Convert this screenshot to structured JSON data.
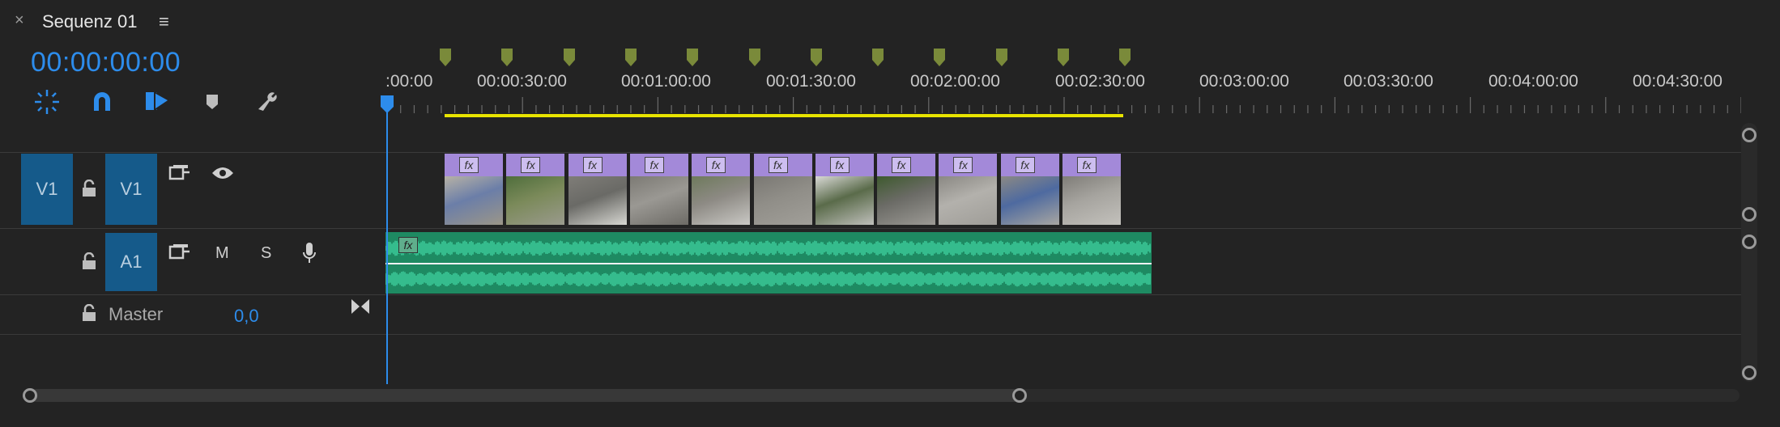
{
  "panel": {
    "close_glyph": "×",
    "title": "Sequenz 01",
    "menu_glyph": "≡"
  },
  "timecode": "00:00:00:00",
  "toolbar": {
    "tools": [
      "snap-insert-icon",
      "magnet-icon",
      "linked-selection-icon",
      "add-marker-icon",
      "wrench-icon"
    ]
  },
  "ruler": {
    "labels": [
      ":00:00",
      "00:00:30:00",
      "00:01:00:00",
      "00:01:30:00",
      "00:02:00:00",
      "00:02:30:00",
      "00:03:00:00",
      "00:03:30:00",
      "00:04:00:00",
      "00:04:30:00"
    ]
  },
  "tracks": {
    "v1": {
      "source_label": "V1",
      "target_label": "V1"
    },
    "a1": {
      "target_label": "A1",
      "mute_label": "M",
      "solo_label": "S"
    },
    "master": {
      "label": "Master",
      "value": "0,0"
    }
  },
  "clips": {
    "video_count": 11,
    "fx_label": "fx"
  },
  "colors": {
    "accent_blue": "#2d8ceb",
    "track_tile": "#155a8a",
    "clip_fx_band": "#a389d9",
    "audio_clip": "#1e8a62",
    "workarea": "#e8e400",
    "marker": "#7a8a3a"
  }
}
